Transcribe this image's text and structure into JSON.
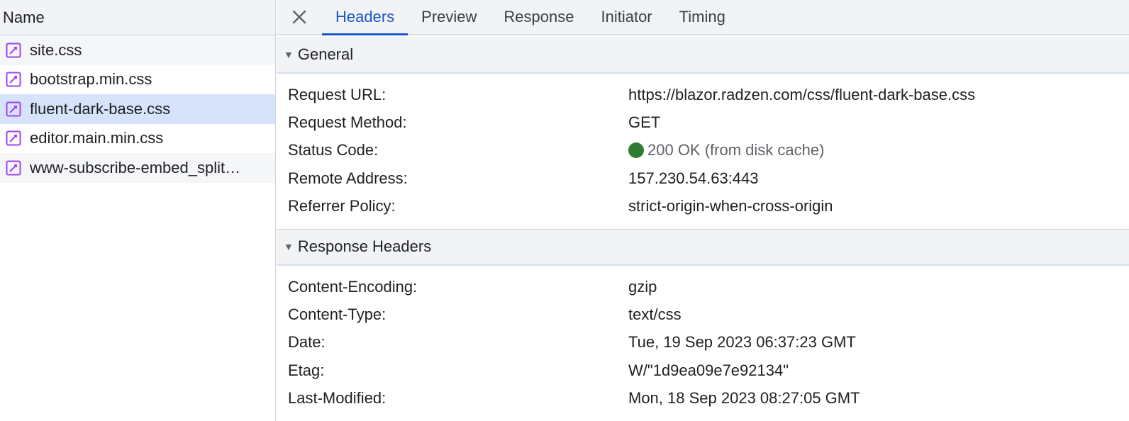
{
  "left": {
    "header": "Name",
    "requests": [
      {
        "name": "site.css",
        "icon": "css-file-icon",
        "state": "alt"
      },
      {
        "name": "bootstrap.min.css",
        "icon": "css-file-icon",
        "state": ""
      },
      {
        "name": "fluent-dark-base.css",
        "icon": "css-file-icon",
        "state": "selected"
      },
      {
        "name": "editor.main.min.css",
        "icon": "css-file-icon",
        "state": ""
      },
      {
        "name": "www-subscribe-embed_split…",
        "icon": "css-file-icon",
        "state": "alt"
      }
    ]
  },
  "tabs": {
    "close_icon": "close-icon",
    "items": [
      "Headers",
      "Preview",
      "Response",
      "Initiator",
      "Timing"
    ],
    "active": "Headers"
  },
  "general": {
    "title": "General",
    "rows": [
      {
        "key": "Request URL:",
        "value": "https://blazor.radzen.com/css/fluent-dark-base.css"
      },
      {
        "key": "Request Method:",
        "value": "GET"
      },
      {
        "key": "Status Code:",
        "value": "200 OK (from disk cache)"
      },
      {
        "key": "Remote Address:",
        "value": "157.230.54.63:443"
      },
      {
        "key": "Referrer Policy:",
        "value": "strict-origin-when-cross-origin"
      }
    ]
  },
  "response_headers": {
    "title": "Response Headers",
    "rows": [
      {
        "key": "Content-Encoding:",
        "value": "gzip"
      },
      {
        "key": "Content-Type:",
        "value": "text/css"
      },
      {
        "key": "Date:",
        "value": "Tue, 19 Sep 2023 06:37:23 GMT"
      },
      {
        "key": "Etag:",
        "value": "W/\"1d9ea09e7e92134\""
      },
      {
        "key": "Last-Modified:",
        "value": "Mon, 18 Sep 2023 08:27:05 GMT"
      }
    ]
  },
  "colors": {
    "accent": "#1a56c9",
    "selected_row": "#d6e3fb",
    "status_ok": "#2e7d32",
    "css_icon": "#a142f4"
  }
}
